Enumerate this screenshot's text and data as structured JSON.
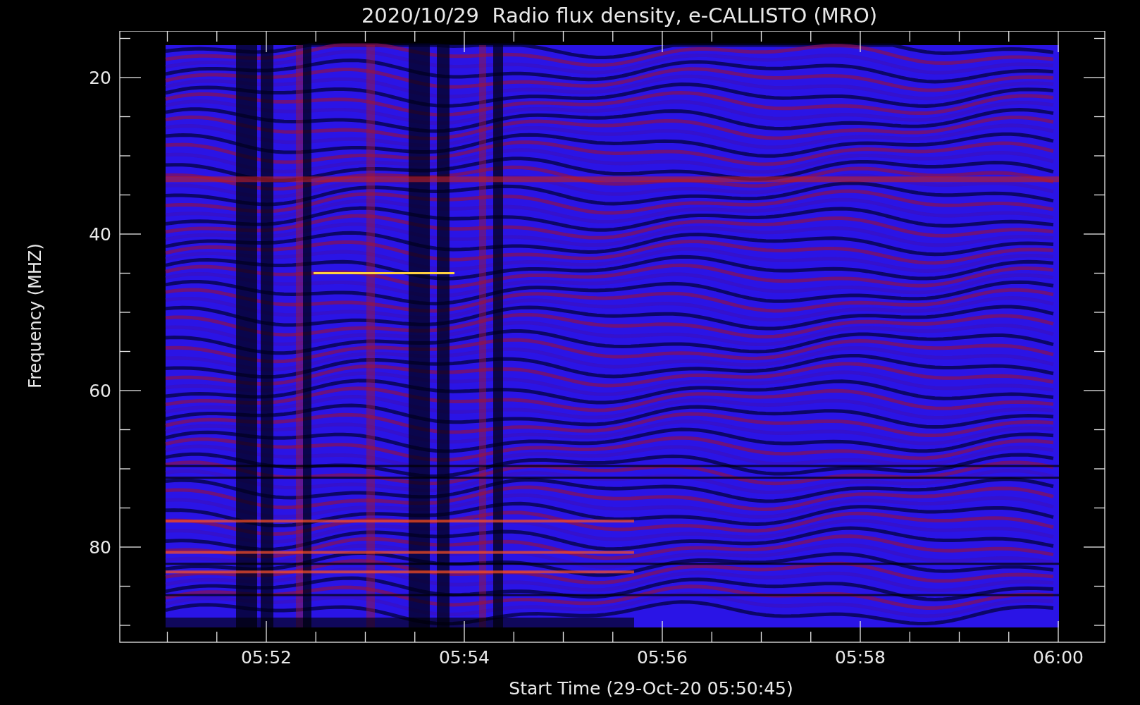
{
  "title": "2020/10/29  Radio flux density, e-CALLISTO (MRO)",
  "y_axis": {
    "label": "Frequency (MHZ)",
    "ticks": [
      "20",
      "40",
      "60",
      "80"
    ]
  },
  "x_axis": {
    "label": "Start Time (29-Oct-20 05:50:45)",
    "ticks": [
      "05:52",
      "05:54",
      "05:56",
      "05:58",
      "06:00"
    ]
  }
}
